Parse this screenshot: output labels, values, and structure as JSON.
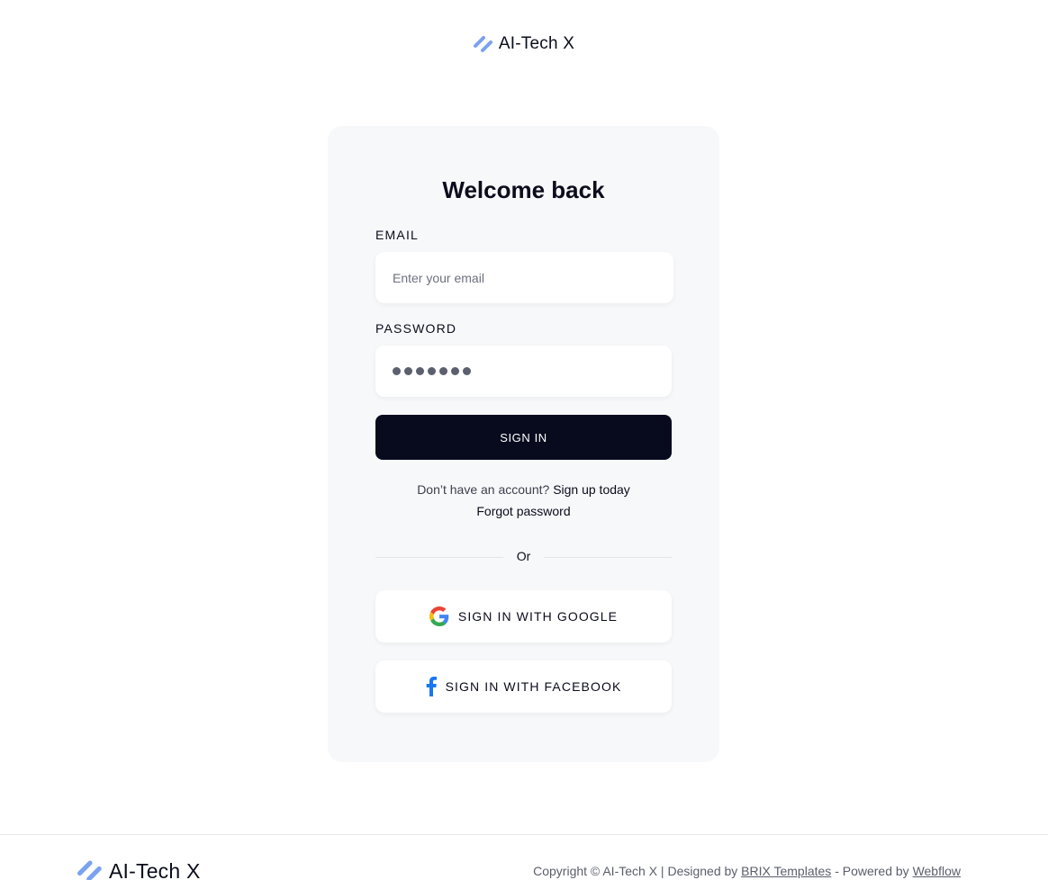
{
  "brand": {
    "name": "AI-Tech X",
    "icon": "logo-mark-icon",
    "accent_color": "#7aa2f0"
  },
  "login": {
    "title": "Welcome back",
    "email_label": "EMAIL",
    "email_placeholder": "Enter your email",
    "email_value": "",
    "password_label": "PASSWORD",
    "password_masked_length": 7,
    "sign_in_label": "SIGN IN",
    "no_account_text": "Don’t have an account?",
    "sign_up_link": "Sign up today",
    "forgot_password": "Forgot password",
    "divider_text": "Or",
    "google_label": "SIGN IN WITH GOOGLE",
    "google_icon": "google-icon",
    "facebook_label": "SIGN IN WITH FACEBOOK",
    "facebook_icon": "facebook-icon"
  },
  "footer": {
    "copyright_prefix": "Copyright © AI-Tech X | Designed by",
    "designer_link": "BRIX Templates",
    "powered_prefix": "- Powered by",
    "powered_link": "Webflow"
  },
  "colors": {
    "primary_button": "#080a1e",
    "card_background": "#f7f8fa",
    "facebook_blue": "#1877f2"
  }
}
